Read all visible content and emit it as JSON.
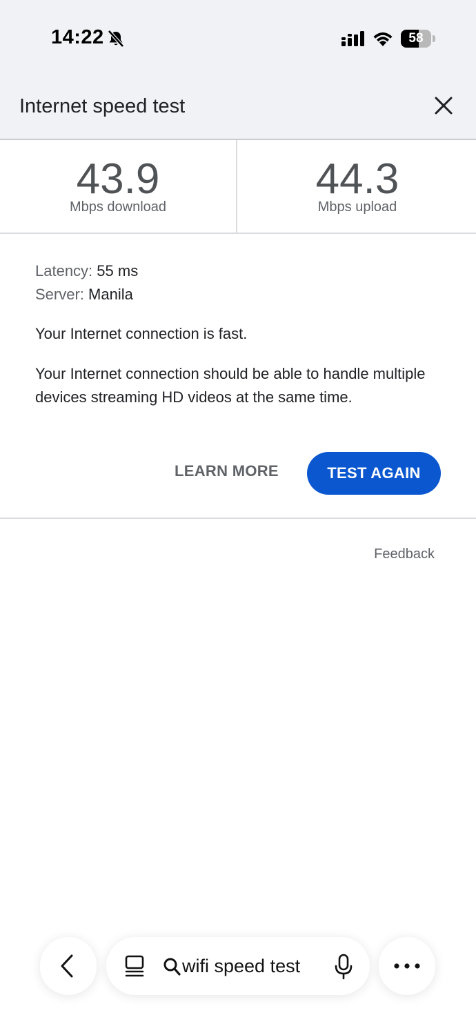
{
  "status_bar": {
    "time": "14:22",
    "battery": "58",
    "battery_level": 0.58
  },
  "header": {
    "title": "Internet speed test"
  },
  "results": {
    "download": {
      "value": "43.9",
      "label": "Mbps download"
    },
    "upload": {
      "value": "44.3",
      "label": "Mbps upload"
    }
  },
  "details": {
    "latency_label": "Latency:",
    "latency_value": "55 ms",
    "server_label": "Server:",
    "server_value": "Manila"
  },
  "messages": {
    "headline": "Your Internet connection is fast.",
    "description": "Your Internet connection should be able to handle multiple devices streaming HD videos at the same time."
  },
  "actions": {
    "learn_more": "LEARN MORE",
    "test_again": "TEST AGAIN",
    "accent_color": "#0b57d0"
  },
  "feedback": "Feedback",
  "bottom_bar": {
    "query": "wifi speed test"
  }
}
